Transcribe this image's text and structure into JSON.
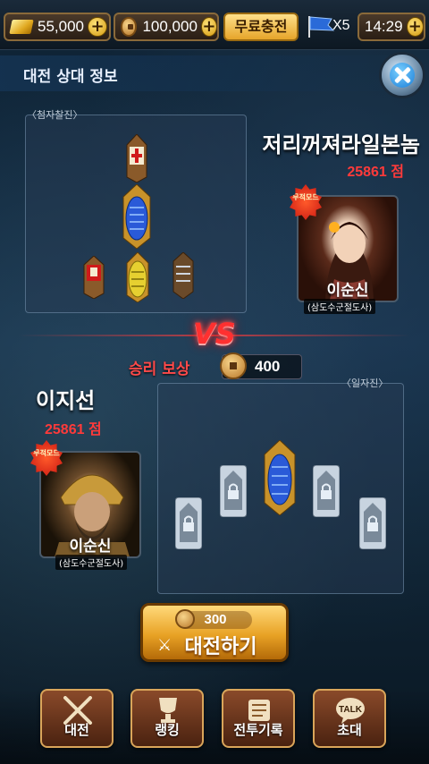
{
  "topbar": {
    "gold": "55,000",
    "coins": "100,000",
    "free_charge": "무료충전",
    "flags": "X5",
    "timer": "14:29"
  },
  "header": {
    "title": "대전 상대 정보"
  },
  "opponent": {
    "formation_label": "〈첨자찰진〉",
    "name": "저리꺼져라일본놈",
    "score": "25861 점",
    "badge": "무적모드",
    "hero_name": "이순신",
    "hero_title": "(삼도수군절도사)"
  },
  "vs": "VS",
  "reward": {
    "label": "승리 보상",
    "amount": "400"
  },
  "player": {
    "formation_label": "〈일자진〉",
    "name": "이지선",
    "score": "25861 점",
    "badge": "무적모드",
    "hero_name": "이순신",
    "hero_title": "(삼도수군절도사)"
  },
  "battle": {
    "cost": "300",
    "label": "대전하기"
  },
  "nav": {
    "battle": "대전",
    "ranking": "랭킹",
    "record": "전투기록",
    "invite": "초대",
    "talk_badge": "TALK"
  },
  "colors": {
    "score_red": "#ff3a3a",
    "accent_gold": "#e8a225",
    "nav_border": "#d9a55a"
  }
}
